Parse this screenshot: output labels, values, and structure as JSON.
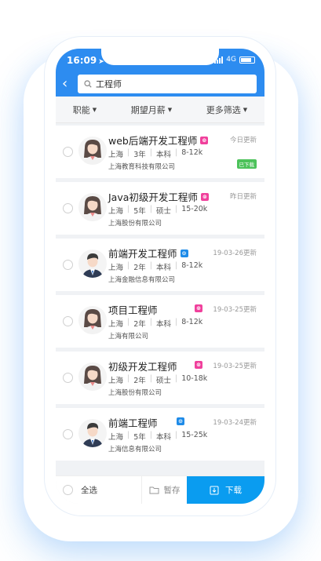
{
  "status": {
    "time": "16:09",
    "network": "4G"
  },
  "search": {
    "query": "工程师"
  },
  "filters": [
    {
      "label": "职能"
    },
    {
      "label": "期望月薪"
    },
    {
      "label": "更多筛选"
    }
  ],
  "jobs": [
    {
      "title": "web后端开发工程师",
      "badge": "pink",
      "date": "今日更新",
      "city": "上海",
      "exp": "3年",
      "edu": "本科",
      "salary": "8-12k",
      "company": "上海教育科技有限公司",
      "downloaded": "已下载",
      "avatar": "female"
    },
    {
      "title": "Java初级开发工程师",
      "badge": "pink",
      "date": "昨日更新",
      "city": "上海",
      "exp": "5年",
      "edu": "硕士",
      "salary": "15-20k",
      "company": "上海股份有限公司",
      "downloaded": "",
      "avatar": "female"
    },
    {
      "title": "前端开发工程师",
      "badge": "blue",
      "date": "19-03-26更新",
      "city": "上海",
      "exp": "2年",
      "edu": "本科",
      "salary": "8-12k",
      "company": "上海金融信息有限公司",
      "downloaded": "",
      "avatar": "male"
    },
    {
      "title": "项目工程师",
      "badge": "pink",
      "date": "19-03-25更新",
      "city": "上海",
      "exp": "2年",
      "edu": "本科",
      "salary": "8-12k",
      "company": "上海有限公司",
      "downloaded": "",
      "avatar": "female"
    },
    {
      "title": "初级开发工程师",
      "badge": "pink",
      "date": "19-03-25更新",
      "city": "上海",
      "exp": "2年",
      "edu": "硕士",
      "salary": "10-18k",
      "company": "上海股份有限公司",
      "downloaded": "",
      "avatar": "female"
    },
    {
      "title": "前端工程师",
      "badge": "blue",
      "date": "19-03-24更新",
      "city": "上海",
      "exp": "5年",
      "edu": "本科",
      "salary": "15-25k",
      "company": "上海信息有限公司",
      "downloaded": "",
      "avatar": "male"
    }
  ],
  "bottom": {
    "select_all": "全选",
    "save": "暂存",
    "download": "下载"
  },
  "colors": {
    "primary": "#2d8cf0",
    "download": "#0a9cf0",
    "pink_badge": "#f0409c",
    "blue_badge": "#1e8be8",
    "downloaded": "#4cc25a"
  }
}
